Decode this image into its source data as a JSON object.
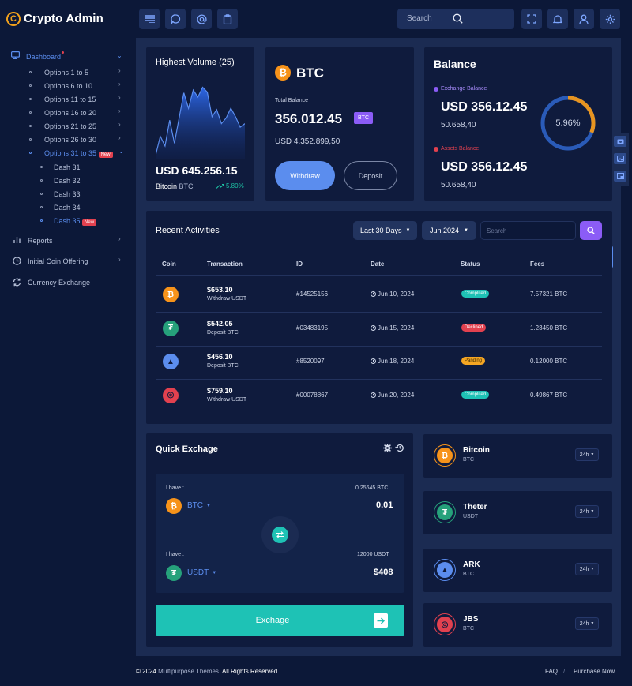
{
  "app": {
    "title": "Crypto Admin",
    "logo_letter": "C"
  },
  "topbar": {
    "search_placeholder": "Search"
  },
  "sidebar": {
    "dashboard": "Dashboard",
    "options": [
      {
        "label": "Options 1 to 5"
      },
      {
        "label": "Options 6 to 10"
      },
      {
        "label": "Options 11 to 15"
      },
      {
        "label": "Options 16 to 20"
      },
      {
        "label": "Options 21 to 25"
      },
      {
        "label": "Options 26 to 30"
      },
      {
        "label": "Options 31 to 35",
        "badge": "New"
      }
    ],
    "dash_items": [
      {
        "label": "Dash 31"
      },
      {
        "label": "Dash 32"
      },
      {
        "label": "Dash 33"
      },
      {
        "label": "Dash 34"
      },
      {
        "label": "Dash 35",
        "badge": "New"
      }
    ],
    "reports": "Reports",
    "ico": "Initial Coin Offering",
    "currency": "Currency Exchange"
  },
  "volume": {
    "title": "Highest Volume (25)",
    "amount": "USD 645.256.15",
    "coin": "Bitcoin",
    "coin_code": "BTC",
    "change": "5.80%",
    "trend": [
      5,
      32,
      18,
      55,
      22,
      58,
      94,
      72,
      98,
      88,
      102,
      95,
      60,
      70,
      50,
      58,
      72,
      60,
      45,
      50
    ]
  },
  "btc": {
    "title": "BTC",
    "total_label": "Total Balance",
    "total_value": "356.012.45",
    "badge": "BTC",
    "usd": "USD 4.352.899,50",
    "withdraw": "Withdraw",
    "deposit": "Deposit"
  },
  "balance": {
    "title": "Balance",
    "exchange_label": "Exchange Balance",
    "exchange_value": "USD 356.12.45",
    "exchange_sub": "50.658,40",
    "assets_label": "Assets Balance",
    "assets_value": "USD 356.12.45",
    "assets_sub": "50.658,40",
    "percent": "5.96%",
    "percent_value": 0.0596
  },
  "activities": {
    "title": "Recent Activities",
    "filter_range": "Last 30 Days",
    "filter_month": "Jun 2024",
    "search_placeholder": "Search",
    "columns": [
      "Coin",
      "Transaction",
      "ID",
      "Date",
      "Status",
      "Fees"
    ],
    "rows": [
      {
        "amount": "$653.10",
        "type": "Withdraw USDT",
        "id": "#14525156",
        "date": "Jun 10, 2024",
        "status": "Complited",
        "fee": "7.57321 BTC"
      },
      {
        "amount": "$542.05",
        "type": "Deposit BTC",
        "id": "#03483195",
        "date": "Jun 15, 2024",
        "status": "Declined",
        "fee": "1.23450 BTC"
      },
      {
        "amount": "$456.10",
        "type": "Deposit BTC",
        "id": "#8520097",
        "date": "Jun 18, 2024",
        "status": "Panding",
        "fee": "0.12000 BTC"
      },
      {
        "amount": "$759.10",
        "type": "Withdraw USDT",
        "id": "#00078867",
        "date": "Jun 20, 2024",
        "status": "Complited",
        "fee": "0.49867 BTC"
      }
    ]
  },
  "exchange": {
    "title": "Quick Exchage",
    "have_label": "I have :",
    "from_balance": "0.25645 BTC",
    "from_coin": "BTC",
    "from_value": "0.01",
    "to_balance": "12000 USDT",
    "to_coin": "USDT",
    "to_value": "$408",
    "button": "Exchage"
  },
  "coins": [
    {
      "name": "Bitcoin",
      "code": "BTC",
      "period": "24h"
    },
    {
      "name": "Theter",
      "code": "USDT",
      "period": "24h"
    },
    {
      "name": "ARK",
      "code": "BTC",
      "period": "24h"
    },
    {
      "name": "JBS",
      "code": "BTC",
      "period": "24h"
    }
  ],
  "footer": {
    "copyright_prefix": "© 2024",
    "company": "Multipurpose Themes",
    "rights": ". All Rights Reserved.",
    "faq": "FAQ",
    "separator": "/",
    "purchase": "Purchase Now"
  },
  "colors": {
    "accent": "#5b8dee",
    "bitcoin": "#f7931a",
    "tether": "#26a17b",
    "teal": "#1ec2b5",
    "danger": "#e2414f",
    "warning": "#f5a623",
    "purple": "#8b5cf6"
  }
}
